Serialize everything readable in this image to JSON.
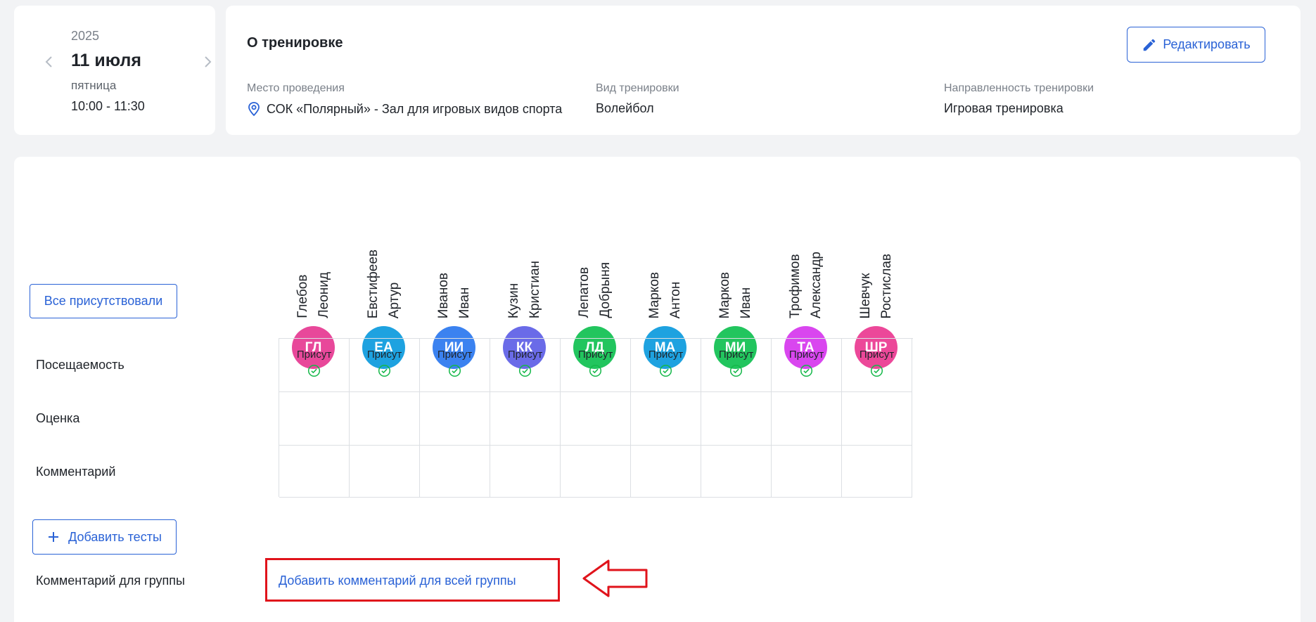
{
  "date_card": {
    "year": "2025",
    "day": "11 июля",
    "weekday": "пятница",
    "time": "10:00 - 11:30",
    "prev_icon": "chevron-left-icon",
    "next_icon": "chevron-right-icon"
  },
  "info": {
    "title": "О тренировке",
    "edit_label": "Редактировать",
    "place_label": "Место проведения",
    "place_value": "СОК «Полярный» - Зал для игровых видов спорта",
    "type_label": "Вид тренировки",
    "type_value": "Волейбол",
    "direction_label": "Направленность тренировки",
    "direction_value": "Игровая тренировка"
  },
  "main": {
    "all_present_label": "Все присутствовали",
    "rows": {
      "attendance": "Посещаемость",
      "grade": "Оценка",
      "comment": "Комментарий"
    },
    "add_tests_label": "Добавить тесты",
    "group_comment_label": "Комментарий для группы",
    "add_group_comment_link": "Добавить комментарий для всей группы"
  },
  "athletes": [
    {
      "name": "Глебов\nЛеонид",
      "initials": "ГЛ",
      "color": "#e8489a",
      "status": "Присут"
    },
    {
      "name": "Евстифеев\nАртур",
      "initials": "ЕА",
      "color": "#1ea2e0",
      "status": "Присут"
    },
    {
      "name": "Иванов\nИван",
      "initials": "ИИ",
      "color": "#3b82f0",
      "status": "Присут"
    },
    {
      "name": "Кузин\nКристиан",
      "initials": "КК",
      "color": "#6a6be8",
      "status": "Присут"
    },
    {
      "name": "Лепатов\nДобрыня",
      "initials": "ЛД",
      "color": "#22c55e",
      "status": "Присут"
    },
    {
      "name": "Марков\nАнтон",
      "initials": "МА",
      "color": "#1ea2e0",
      "status": "Присут"
    },
    {
      "name": "Марков\nИван",
      "initials": "МИ",
      "color": "#22c55e",
      "status": "Присут"
    },
    {
      "name": "Трофимов\nАлександр",
      "initials": "ТА",
      "color": "#d946ef",
      "status": "Присут"
    },
    {
      "name": "Шевчук\nРостислав",
      "initials": "ШР",
      "color": "#ec4899",
      "status": "Присут"
    }
  ],
  "colors": {
    "accent": "#2a62d6",
    "check": "#16b84a",
    "annotation": "#e0131b"
  }
}
